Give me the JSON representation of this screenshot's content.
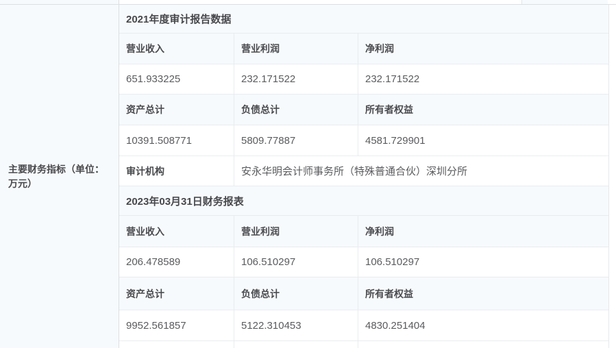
{
  "colors": {
    "row_tint": "#f7fafd",
    "border_inner": "#e9ecef",
    "border_outer": "#dcdfe2",
    "header_text": "#4a4b4e",
    "value_text": "#5a5b5e"
  },
  "left_column": {
    "label": "主要财务指标（单位：万元）"
  },
  "sections": [
    {
      "title": "2021年度审计报告数据",
      "groups": [
        {
          "headers": [
            "营业收入",
            "营业利润",
            "净利润"
          ],
          "values": [
            "651.933225",
            "232.171522",
            "232.171522"
          ]
        },
        {
          "headers": [
            "资产总计",
            "负债总计",
            "所有者权益"
          ],
          "values": [
            "10391.508771",
            "5809.77887",
            "4581.729901"
          ]
        }
      ],
      "audit_label": "审计机构",
      "audit_value": "安永华明会计师事务所（特殊普通合伙）深圳分所"
    },
    {
      "title": "2023年03月31日财务报表",
      "groups": [
        {
          "headers": [
            "营业收入",
            "营业利润",
            "净利润"
          ],
          "values": [
            "206.478589",
            "106.510297",
            "106.510297"
          ]
        },
        {
          "headers": [
            "资产总计",
            "负债总计",
            "所有者权益"
          ],
          "values": [
            "9952.561857",
            "5122.310453",
            "4830.251404"
          ]
        }
      ]
    }
  ]
}
